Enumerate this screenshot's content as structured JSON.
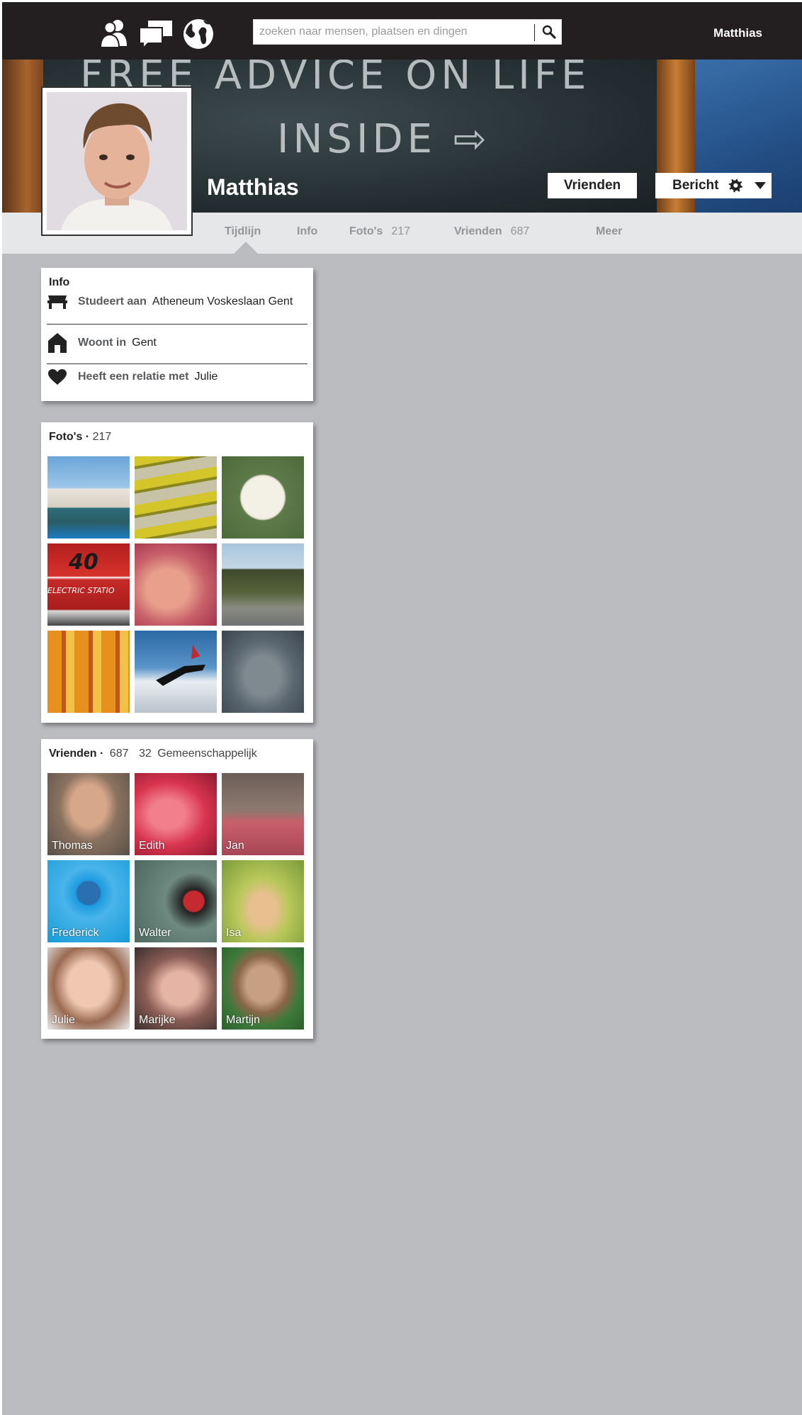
{
  "header": {
    "search_placeholder": "zoeken naar mensen, plaatsen en dingen",
    "user_name": "Matthias",
    "nav_icons": [
      "friends-icon",
      "messages-icon",
      "notifications-globe-icon"
    ]
  },
  "cover": {
    "chalk_line1": "FREE ADVICE ON LIFE",
    "chalk_line2": "INSIDE ⇨"
  },
  "profile": {
    "name": "Matthias",
    "friends_button": "Vrienden",
    "message_button": "Bericht",
    "settings_icon": "gear-icon",
    "dropdown_icon": "caret-down-icon"
  },
  "tabs": [
    {
      "label": "Tijdlijn",
      "count": ""
    },
    {
      "label": "Info",
      "count": ""
    },
    {
      "label": "Foto's",
      "count": "217"
    },
    {
      "label": "Vrienden",
      "count": "687"
    },
    {
      "label": "Meer",
      "count": ""
    }
  ],
  "info": {
    "title": "Info",
    "rows": [
      {
        "icon": "school-icon",
        "label": "Studeert aan",
        "value": "Atheneum Voskeslaan Gent"
      },
      {
        "icon": "home-icon",
        "label": "Woont in",
        "value": "Gent"
      },
      {
        "icon": "heart-icon",
        "label": "Heeft een relatie met",
        "value": "Julie"
      }
    ]
  },
  "photos": {
    "title": "Foto's",
    "count": "217"
  },
  "friends": {
    "title": "Vrienden",
    "count": "687",
    "mutual_count": "32",
    "mutual_label": "Gemeenschappelijk",
    "people": [
      "Thomas",
      "Edith",
      "Jan",
      "Frederick",
      "Walter",
      "Isa",
      "Julie",
      "Marijke",
      "Martijn"
    ]
  },
  "colors": {
    "topbar": "#231f20",
    "page_bg": "#bbbcc0",
    "tabbar": "#e6e7e8",
    "tab_text": "#939598"
  }
}
